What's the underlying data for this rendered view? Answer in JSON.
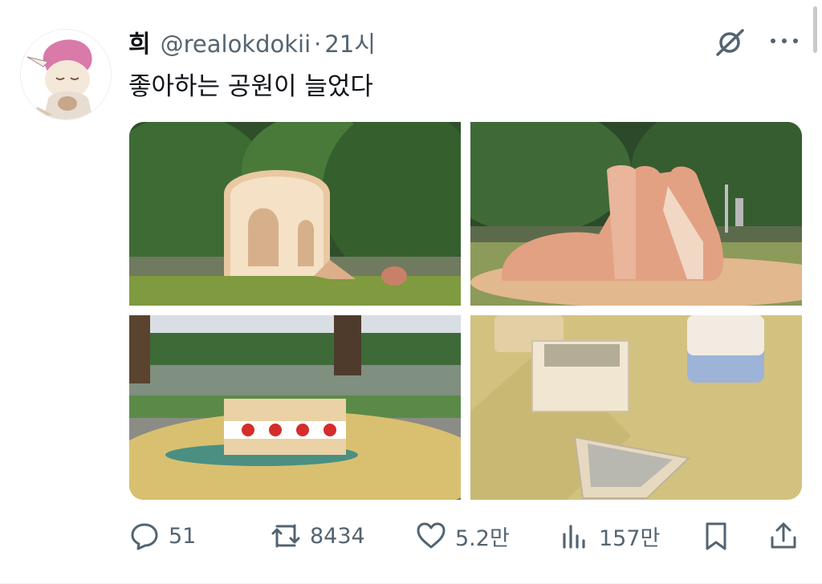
{
  "tweet": {
    "author_name": "희",
    "handle": "@realokdokii",
    "separator": "·",
    "time": "21시",
    "text": "좋아하는 공원이 늘었다"
  },
  "media": {
    "photos": [
      {
        "description": "bread-slice-shaped playground structure"
      },
      {
        "description": "pink loaf-shaped slide"
      },
      {
        "description": "sandwich-shaped bench"
      },
      {
        "description": "cheese and sign stones on ground"
      }
    ]
  },
  "actions": {
    "replies": "51",
    "reposts": "8434",
    "likes": "5.2만",
    "views": "157만"
  },
  "icons": {
    "reply": "reply-icon",
    "repost": "repost-icon",
    "like": "heart-icon",
    "views": "views-icon",
    "bookmark": "bookmark-icon",
    "share": "share-icon",
    "grok": "grok-icon",
    "more": "more-icon"
  },
  "colors": {
    "text_primary": "#0f1419",
    "text_secondary": "#536471"
  }
}
